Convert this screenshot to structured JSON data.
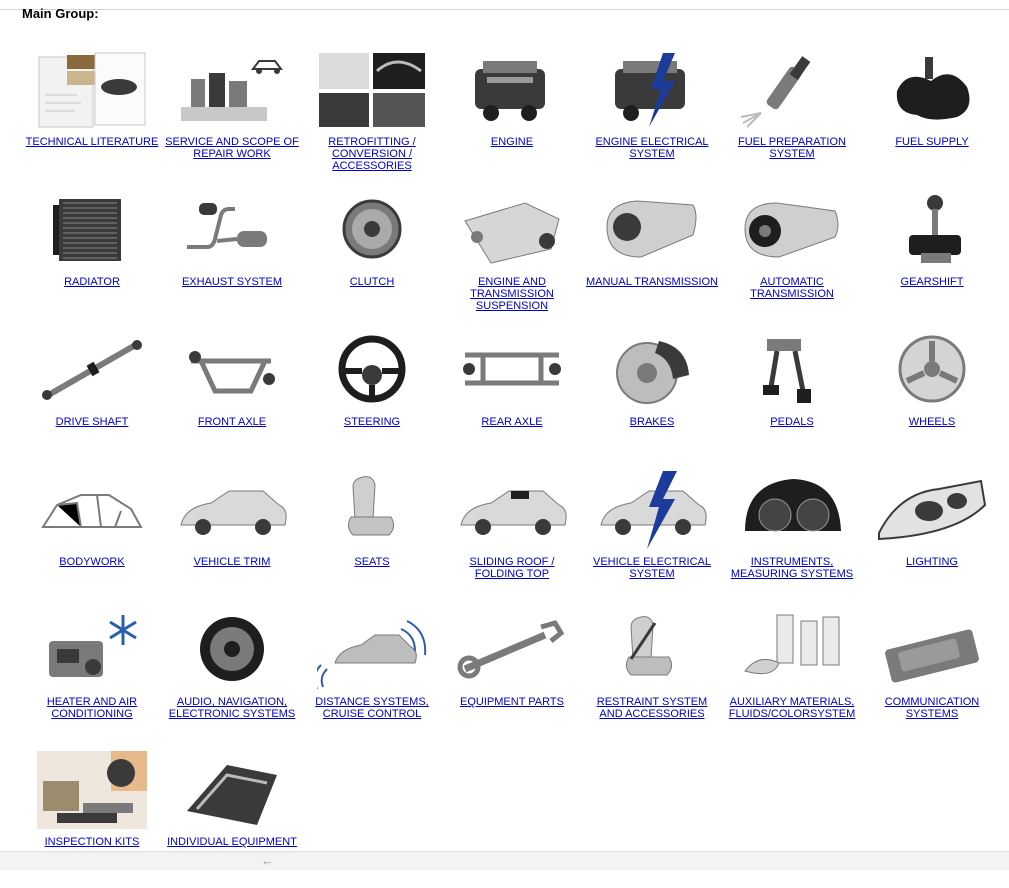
{
  "page": {
    "heading": "Main Group:"
  },
  "groups": [
    {
      "label": "TECHNICAL LITERATURE",
      "icon": "technical-literature-thumbnail"
    },
    {
      "label": "SERVICE AND SCOPE OF REPAIR WORK",
      "icon": "service-scope-thumbnail"
    },
    {
      "label": "RETROFITTING / CONVERSION / ACCESSORIES",
      "icon": "retrofitting-thumbnail"
    },
    {
      "label": "ENGINE",
      "icon": "engine-thumbnail"
    },
    {
      "label": "ENGINE ELECTRICAL SYSTEM",
      "icon": "engine-electrical-thumbnail"
    },
    {
      "label": "FUEL PREPARATION SYSTEM",
      "icon": "fuel-preparation-thumbnail"
    },
    {
      "label": "FUEL SUPPLY",
      "icon": "fuel-supply-thumbnail"
    },
    {
      "label": "RADIATOR",
      "icon": "radiator-thumbnail"
    },
    {
      "label": "EXHAUST SYSTEM",
      "icon": "exhaust-thumbnail"
    },
    {
      "label": "CLUTCH",
      "icon": "clutch-thumbnail"
    },
    {
      "label": "ENGINE AND TRANSMISSION SUSPENSION",
      "icon": "engine-transmission-suspension-thumbnail"
    },
    {
      "label": "MANUAL TRANSMISSION",
      "icon": "manual-transmission-thumbnail"
    },
    {
      "label": "AUTOMATIC TRANSMISSION",
      "icon": "automatic-transmission-thumbnail"
    },
    {
      "label": "GEARSHIFT",
      "icon": "gearshift-thumbnail"
    },
    {
      "label": "DRIVE SHAFT",
      "icon": "drive-shaft-thumbnail"
    },
    {
      "label": "FRONT AXLE",
      "icon": "front-axle-thumbnail"
    },
    {
      "label": "STEERING",
      "icon": "steering-wheel-thumbnail"
    },
    {
      "label": "REAR AXLE",
      "icon": "rear-axle-thumbnail"
    },
    {
      "label": "BRAKES",
      "icon": "brakes-thumbnail"
    },
    {
      "label": "PEDALS",
      "icon": "pedals-thumbnail"
    },
    {
      "label": "WHEELS",
      "icon": "wheel-thumbnail"
    },
    {
      "label": "BODYWORK",
      "icon": "bodywork-thumbnail"
    },
    {
      "label": "VEHICLE TRIM",
      "icon": "vehicle-trim-thumbnail"
    },
    {
      "label": "SEATS",
      "icon": "seat-thumbnail"
    },
    {
      "label": "SLIDING ROOF / FOLDING TOP",
      "icon": "sliding-roof-thumbnail"
    },
    {
      "label": "VEHICLE ELECTRICAL SYSTEM",
      "icon": "vehicle-electrical-thumbnail"
    },
    {
      "label": "INSTRUMENTS, MEASURING SYSTEMS",
      "icon": "instruments-thumbnail"
    },
    {
      "label": "LIGHTING",
      "icon": "headlight-thumbnail"
    },
    {
      "label": "HEATER AND AIR CONDITIONING",
      "icon": "heater-ac-thumbnail"
    },
    {
      "label": "AUDIO, NAVIGATION, ELECTRONIC SYSTEMS",
      "icon": "speaker-thumbnail"
    },
    {
      "label": "DISTANCE SYSTEMS, CRUISE CONTROL",
      "icon": "distance-systems-thumbnail"
    },
    {
      "label": "EQUIPMENT PARTS",
      "icon": "wrench-thumbnail"
    },
    {
      "label": "RESTRAINT SYSTEM AND ACCESSORIES",
      "icon": "restraint-system-thumbnail"
    },
    {
      "label": "AUXILIARY MATERIALS, FLUIDS/COLORSYSTEM",
      "icon": "auxiliary-materials-thumbnail"
    },
    {
      "label": "COMMUNICATION SYSTEMS",
      "icon": "communication-thumbnail"
    },
    {
      "label": "INSPECTION KITS",
      "icon": "inspection-kits-thumbnail"
    },
    {
      "label": "INDIVIDUAL EQUIPMENT",
      "icon": "individual-equipment-thumbnail"
    }
  ],
  "footer": {
    "scroll_icon": "scroll-left-arrow-icon"
  }
}
